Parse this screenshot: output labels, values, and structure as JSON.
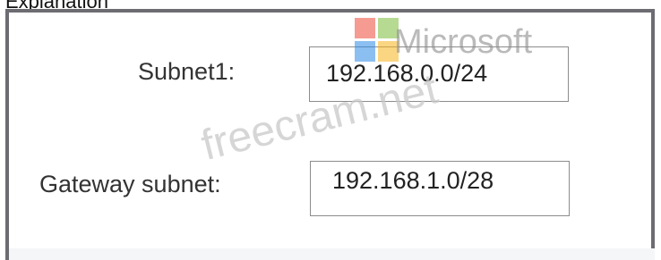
{
  "caption": "Explanation",
  "form": {
    "subnet1": {
      "label": "Subnet1:",
      "value": "192.168.0.0/24"
    },
    "gateway_subnet": {
      "label": "Gateway subnet:",
      "value": "192.168.1.0/28"
    }
  },
  "watermark": {
    "brand": "Microsoft",
    "site": "freecram.net",
    "logo_icon": "microsoft-logo-icon",
    "logo_colors": [
      "#ee4a3a",
      "#7cbc3a",
      "#2f8be6",
      "#f7b51d"
    ]
  },
  "colors": {
    "panel_border": "#6c6c72",
    "field_border": "#8c8c8c"
  }
}
